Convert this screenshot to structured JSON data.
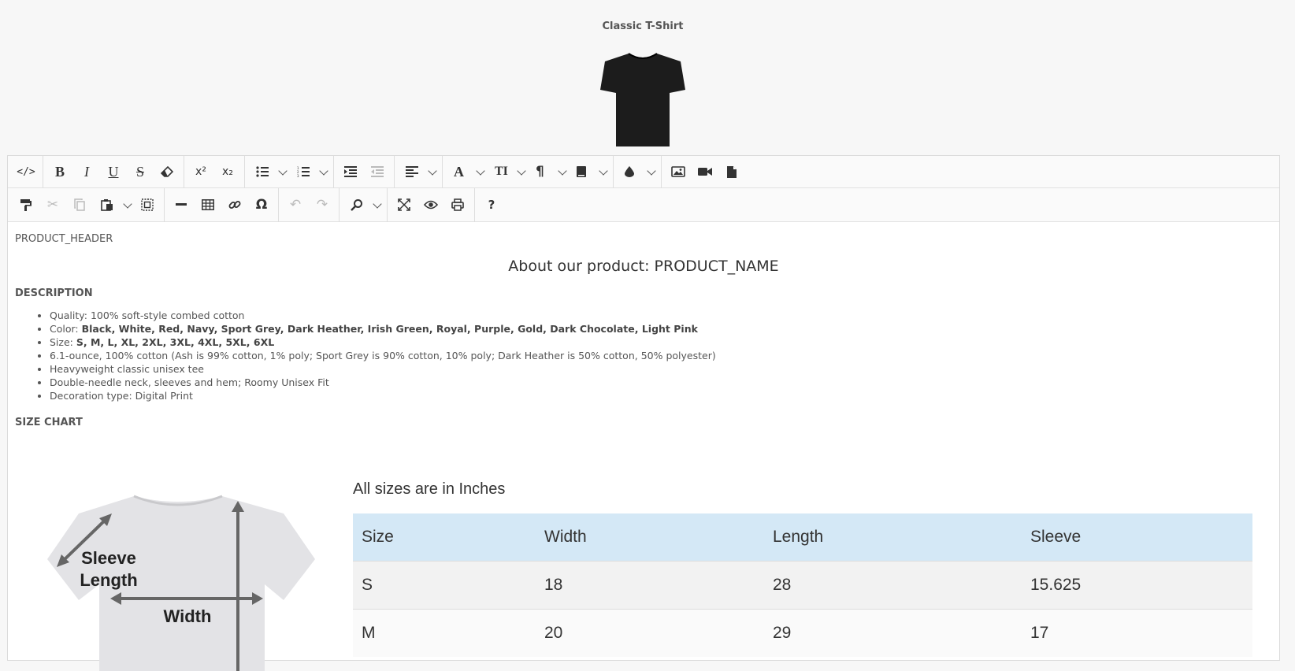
{
  "product": {
    "title": "Classic T-Shirt"
  },
  "toolbar": {
    "row1": [
      "code-view",
      "bold",
      "italic",
      "underline",
      "strikethrough",
      "clear-format",
      "superscript",
      "subscript",
      "unordered-list",
      "ordered-list",
      "indent",
      "outdent",
      "align",
      "font",
      "font-size",
      "paragraph",
      "block-style",
      "color",
      "image",
      "video",
      "file"
    ],
    "row2": [
      "format-painter",
      "cut",
      "copy",
      "paste",
      "select-all",
      "horizontal-rule",
      "table",
      "link",
      "special-character",
      "undo",
      "redo",
      "find-replace",
      "fullscreen",
      "preview",
      "print",
      "help"
    ]
  },
  "content": {
    "header_placeholder": "PRODUCT_HEADER",
    "about_title": "About our product: PRODUCT_NAME",
    "description_heading": "DESCRIPTION",
    "bullets": {
      "quality": "Quality: 100% soft-style combed cotton",
      "color_label": "Color: ",
      "color_value": "Black, White, Red, Navy, Sport Grey, Dark Heather, Irish Green, Royal, Purple, Gold, Dark Chocolate, Light Pink",
      "size_label": "Size: ",
      "size_value": "S, M, L, XL, 2XL, 3XL, 4XL, 5XL, 6XL",
      "fabric": "6.1-ounce, 100% cotton (Ash is 99% cotton, 1% poly; Sport Grey is 90% cotton, 10% poly; Dark Heather is 50% cotton, 50% polyester)",
      "weight": "Heavyweight classic unisex tee",
      "construction": "Double-needle neck, sleeves and hem; Roomy Unisex Fit",
      "decoration": "Decoration type: Digital Print"
    },
    "size_chart_heading": "SIZE CHART",
    "size_note": "All sizes are in Inches",
    "diagram_labels": {
      "sleeve1": "Sleeve",
      "sleeve2": "Length",
      "width": "Width"
    },
    "table": {
      "headers": [
        "Size",
        "Width",
        "Length",
        "Sleeve"
      ],
      "rows": [
        [
          "S",
          "18",
          "28",
          "15.625"
        ],
        [
          "M",
          "20",
          "29",
          "17"
        ]
      ]
    }
  }
}
